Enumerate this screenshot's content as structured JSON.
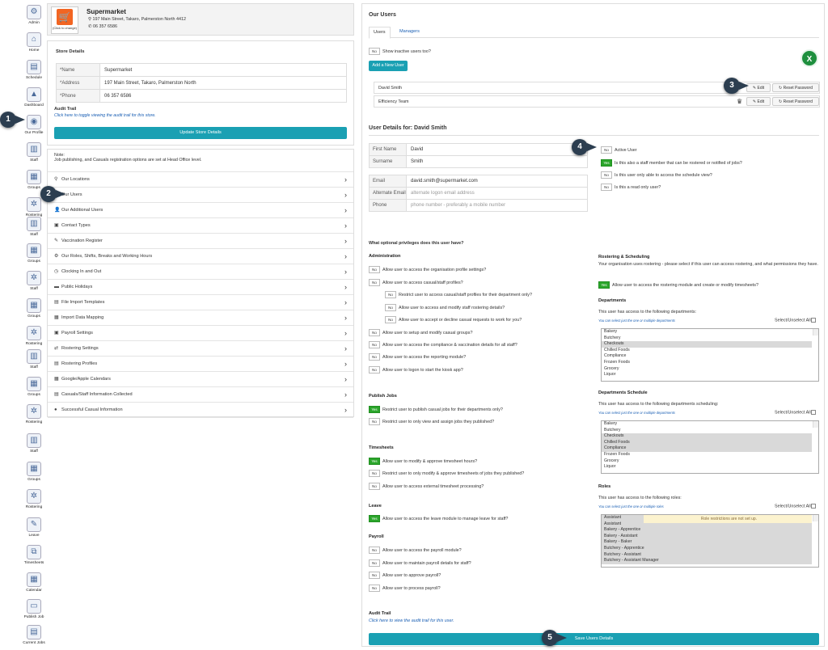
{
  "sidebar": {
    "items": [
      {
        "label": "Admin",
        "icon": "gear-icon",
        "glyph": "⚙"
      },
      {
        "label": "Home",
        "icon": "home-icon",
        "glyph": "⌂"
      },
      {
        "label": "Schedule",
        "icon": "schedule-icon",
        "glyph": "▤"
      },
      {
        "label": "Dashboard",
        "icon": "dashboard-icon",
        "glyph": "▲"
      },
      {
        "label": "Our Profile",
        "icon": "globe-icon",
        "glyph": "◉"
      },
      {
        "label": "Staff",
        "icon": "staff-icon",
        "glyph": "▥"
      },
      {
        "label": "Groups",
        "icon": "groups-icon",
        "glyph": "▦"
      },
      {
        "label": "Rostering",
        "icon": "rostering-icon",
        "glyph": "✲"
      },
      {
        "label": "Staff",
        "icon": "staff-icon",
        "glyph": "▥"
      },
      {
        "label": "Groups",
        "icon": "groups-icon",
        "glyph": "▦"
      },
      {
        "label": "Staff",
        "icon": "staff-icon",
        "glyph": "✲"
      },
      {
        "label": "Groups",
        "icon": "groups-icon",
        "glyph": "▦"
      },
      {
        "label": "Rostering",
        "icon": "rostering-icon",
        "glyph": "✲"
      },
      {
        "label": "Staff",
        "icon": "staff-icon",
        "glyph": "▥"
      },
      {
        "label": "Groups",
        "icon": "groups-icon",
        "glyph": "▦"
      },
      {
        "label": "Rostering",
        "icon": "rostering-icon",
        "glyph": "✲"
      },
      {
        "label": "Staff",
        "icon": "staff-icon",
        "glyph": "▥"
      },
      {
        "label": "Groups",
        "icon": "groups-icon",
        "glyph": "▦"
      },
      {
        "label": "Rostering",
        "icon": "rostering-icon",
        "glyph": "✲"
      },
      {
        "label": "Leave",
        "icon": "leave-icon",
        "glyph": "✎"
      },
      {
        "label": "Timesheets",
        "icon": "timesheets-icon",
        "glyph": "⧉"
      },
      {
        "label": "Calendar",
        "icon": "calendar-icon",
        "glyph": "▦"
      },
      {
        "label": "Publish Job",
        "icon": "publish-job-icon",
        "glyph": "▭"
      },
      {
        "label": "Current Jobs",
        "icon": "current-jobs-icon",
        "glyph": "▤"
      }
    ]
  },
  "callouts": [
    "1",
    "2",
    "3",
    "4",
    "5"
  ],
  "store": {
    "logo_caption": "(Click to change)",
    "name": "Supermarket",
    "address": "197 Main Street, Takaro, Palmerston North 4412",
    "phone": "06 357 6586",
    "details_title": "Store Details",
    "fields": [
      {
        "label": "*Name",
        "value": "Supermarket"
      },
      {
        "label": "*Address",
        "value": "197 Main Street, Takaro, Palmerston North"
      },
      {
        "label": "*Phone",
        "value": "06 357 6586"
      }
    ],
    "audit_title": "Audit Trail",
    "audit_link": "Click here to toggle viewing the audit trail for this store.",
    "update_button": "Update Store Details",
    "note_title": "Note:",
    "note_text": "Job publishing, and Casuals registration options are set at Head Office level."
  },
  "menu": [
    {
      "label": "Our Locations",
      "glyph": "⚲"
    },
    {
      "label": "Our Users",
      "glyph": "👥"
    },
    {
      "label": "Our Additional Users",
      "glyph": "👤"
    },
    {
      "label": "Contact Types",
      "glyph": "▣"
    },
    {
      "label": "Vaccination Register",
      "glyph": "✎"
    },
    {
      "label": "Our Roles, Shifts, Breaks and Working Hours",
      "glyph": "⚙"
    },
    {
      "label": "Clocking In and Out",
      "glyph": "◷"
    },
    {
      "label": "Public Holidays",
      "glyph": "▬"
    },
    {
      "label": "File Import Templates",
      "glyph": "▤"
    },
    {
      "label": "Import Data Mapping",
      "glyph": "▦"
    },
    {
      "label": "Payroll Settings",
      "glyph": "▣"
    },
    {
      "label": "Rostering Settings",
      "glyph": "⇄"
    },
    {
      "label": "Rostering Profiles",
      "glyph": "▤"
    },
    {
      "label": "Google/Apple Calendars",
      "glyph": "▦"
    },
    {
      "label": "Casuals/Staff Information Collected",
      "glyph": "▤"
    },
    {
      "label": "Successful Casual Information",
      "glyph": "●"
    }
  ],
  "users": {
    "title": "Our Users",
    "tabs": [
      "Users",
      "Managers"
    ],
    "show_inactive": "Show inactive users too?",
    "add_button": "Add a New User",
    "rows": [
      {
        "name": "David Smith",
        "edit": "Edit",
        "reset": "Reset Password"
      },
      {
        "name": "Efficiency Team",
        "edit": "Edit",
        "reset": "Reset Password"
      }
    ]
  },
  "details": {
    "title": "User Details for: David Smith",
    "first_name_label": "First Name",
    "first_name": "David",
    "surname_label": "Surname",
    "surname": "Smith",
    "email_label": "Email",
    "email": "david.smith@supermarket.com",
    "alt_email_label": "Alternate Email",
    "alt_email_placeholder": "alternate logon email address",
    "phone_label": "Phone",
    "phone_placeholder": "phone number - preferably a mobile number",
    "flags": [
      {
        "text": "Active User",
        "state": "No"
      },
      {
        "text": "Is this also a staff member that can be rostered or notified of jobs?",
        "state": "Yes"
      },
      {
        "text": "Is this user only able to access the schedule view?",
        "state": "No"
      },
      {
        "text": "Is this a read only user?",
        "state": "No"
      }
    ]
  },
  "privileges": {
    "question": "What optional privileges does this user have?",
    "administration_title": "Administration",
    "administration": [
      {
        "text": "Allow user to access the organisation profile settings?",
        "state": "No",
        "indent": 0
      },
      {
        "text": "Allow user to access casual/staff profiles?",
        "state": "No",
        "indent": 0
      },
      {
        "text": "Restrict user to access casual/staff profiles for their department only?",
        "state": "No",
        "indent": 1
      },
      {
        "text": "Allow user to access and modify staff rostering details?",
        "state": "No",
        "indent": 1
      },
      {
        "text": "Allow user to accept or decline casual requests to work for you?",
        "state": "No",
        "indent": 1
      },
      {
        "text": "Allow user to setup and modify casual groups?",
        "state": "No",
        "indent": 0
      },
      {
        "text": "Allow user to access the compliance & vaccination details for all staff?",
        "state": "No",
        "indent": 0
      },
      {
        "text": "Allow user to access the reporting module?",
        "state": "No",
        "indent": 0
      },
      {
        "text": "Allow user to logon to start the kiosk app?",
        "state": "No",
        "indent": 0
      }
    ],
    "publish_title": "Publish Jobs",
    "publish": [
      {
        "text": "Restrict user to publish casual jobs for their departments only?",
        "state": "Yes"
      },
      {
        "text": "Restrict user to only view and assign jobs they published?",
        "state": "No"
      }
    ],
    "timesheets_title": "Timesheets",
    "timesheets": [
      {
        "text": "Allow user to modify & approve timesheet hours?",
        "state": "Yes"
      },
      {
        "text": "Restrict user to only modify & approve timesheets of jobs they published?",
        "state": "No"
      },
      {
        "text": "Allow user to access external timesheet processing?",
        "state": "No"
      }
    ],
    "leave_title": "Leave",
    "leave": [
      {
        "text": "Allow user to access the leave module to manage leave for staff?",
        "state": "Yes"
      }
    ],
    "payroll_title": "Payroll",
    "payroll": [
      {
        "text": "Allow user to access the payroll module?",
        "state": "No"
      },
      {
        "text": "Allow user to maintain payroll details for staff?",
        "state": "No"
      },
      {
        "text": "Allow user to approve payroll?",
        "state": "No"
      },
      {
        "text": "Allow user to process payroll?",
        "state": "No"
      }
    ],
    "audit_title": "Audit Trail",
    "audit_link": "Click here to view the audit trail for this user.",
    "save_button": "Save Users Details"
  },
  "rostering": {
    "title": "Rostering & Scheduling",
    "desc": "Your organisation uses rostering - please select if this user can access rostering, and what permissions they have.",
    "toggle_text": "Allow user to access the rostering module and create or modify timesheets?",
    "toggle_state": "Yes",
    "departments_title": "Departments",
    "departments_desc": "This user has access to the following departments:",
    "multi_hint": "You can select just the one or multiple departments",
    "select_all": "Select/Unselect All",
    "departments": [
      "Bakery",
      "Butchery",
      "Checkouts",
      "Chilled Foods",
      "Compliance",
      "Frozen Foods",
      "Grocery",
      "Liquor"
    ],
    "departments_selected": [
      "Checkouts"
    ],
    "schedule_title": "Departments Schedule",
    "schedule_desc": "This user has access to the following departments scheduling:",
    "schedule": [
      "Bakery",
      "Butchery",
      "Checkouts",
      "Chilled Foods",
      "Compliance",
      "Frozen Foods",
      "Grocery",
      "Liquor"
    ],
    "schedule_selected": [
      "Checkouts",
      "Chilled Foods",
      "Compliance"
    ],
    "roles_title": "Roles",
    "roles_desc": "This user has access to the following roles:",
    "roles_hint": "You can select just the one or multiple roles",
    "roles": [
      "Assistant",
      "Assistant",
      "Bakery - Apprentice",
      "Bakery - Assistant",
      "Bakery - Baker",
      "Butchery - Apprentice",
      "Butchery - Assistant",
      "Butchery - Assistant Manager"
    ],
    "roles_notice": "Role restrictions are not set up."
  },
  "colors": {
    "accent": "#1aa0b3",
    "toggle_on": "#2aa52a",
    "callout": "#2c3e50",
    "excel": "#1e8f3e"
  }
}
